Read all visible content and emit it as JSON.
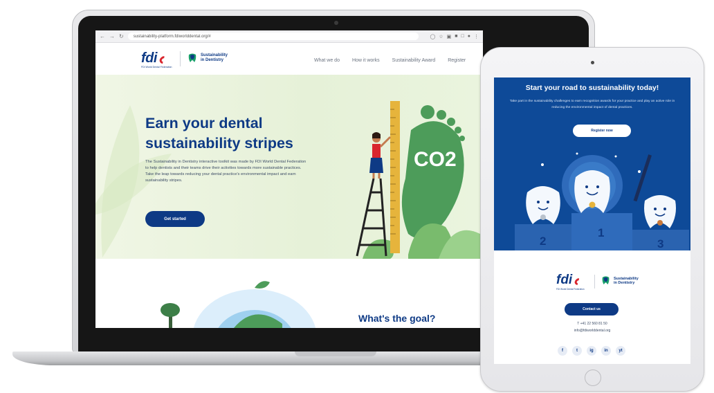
{
  "laptop": {
    "browser": {
      "url": "sustainability-platform.fdiworlddental.org/#",
      "back_icon": "arrow-left-icon",
      "forward_icon": "arrow-right-icon",
      "reload_icon": "reload-icon"
    },
    "header": {
      "logo_text": "fdi",
      "logo_subtext": "FDI World Dental Federation",
      "partner_logo": "Sustainability in Dentistry",
      "partner_logo_line1": "Sustainability",
      "partner_logo_line2": "in Dentistry",
      "nav": [
        "What we do",
        "How it works",
        "Sustainability Award",
        "Register"
      ]
    },
    "hero": {
      "title": "Earn your dental sustainability stripes",
      "text": "The Sustainability in Dentistry interactive toolkit was made by FDI World Dental Federation to help dentists and their teams drive their activities towards more sustainable practices. Take the leap towards reducing your dental practice's environmental impact and earn sustainability stripes.",
      "button": "Get started",
      "illustration_text": "CO2"
    },
    "section": {
      "title": "What's the goal?"
    }
  },
  "tablet": {
    "hero": {
      "title": "Start your road to sustainability today!",
      "text": "Take part in the sustainability challenges to earn recognition awards for your practice and play an active role in reducing the environmental impact of dental practices.",
      "button": "Register now",
      "podium": [
        "2",
        "1",
        "3"
      ]
    },
    "footer": {
      "logo_text": "fdi",
      "logo_subtext": "FDI World Dental Federation",
      "partner_logo_line1": "Sustainability",
      "partner_logo_line2": "in Dentistry",
      "contact_button": "Contact us",
      "phone": "T +41 22 560 81 50",
      "email": "info@fdiworlddental.org",
      "social": [
        "f",
        "t",
        "ig",
        "in",
        "yt"
      ]
    }
  },
  "colors": {
    "brand_blue": "#0e3a85",
    "tablet_blue": "#0e4a98",
    "accent_red": "#d9262e",
    "hero_green": "#e6f1d8",
    "footprint_green": "#4d9c5a"
  }
}
